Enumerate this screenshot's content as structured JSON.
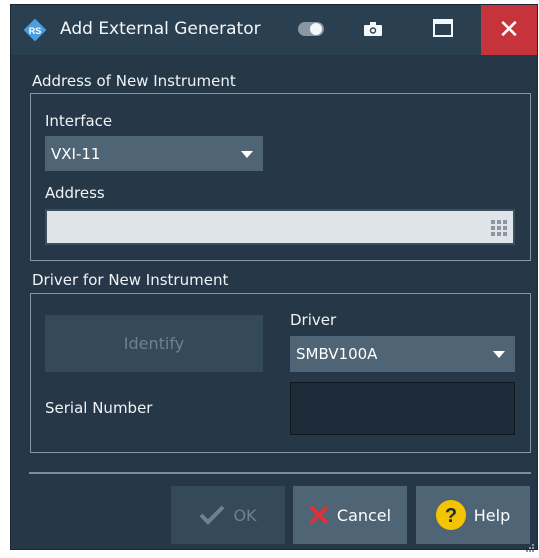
{
  "window": {
    "title": "Add External Generator",
    "close_glyph": "✕"
  },
  "address_group": {
    "title": "Address of New Instrument",
    "interface_label": "Interface",
    "interface_value": "VXI-11",
    "address_label": "Address",
    "address_value": ""
  },
  "driver_group": {
    "title": "Driver for New Instrument",
    "identify_label": "Identify",
    "driver_label": "Driver",
    "driver_value": "SMBV100A",
    "serial_label": "Serial Number",
    "serial_value": ""
  },
  "buttons": {
    "ok_label": "OK",
    "cancel_label": "Cancel",
    "help_label": "Help"
  },
  "colors": {
    "background": "#263847",
    "accent_close": "#c6333b",
    "help_icon": "#f2c500",
    "cancel_icon": "#e0303a"
  }
}
